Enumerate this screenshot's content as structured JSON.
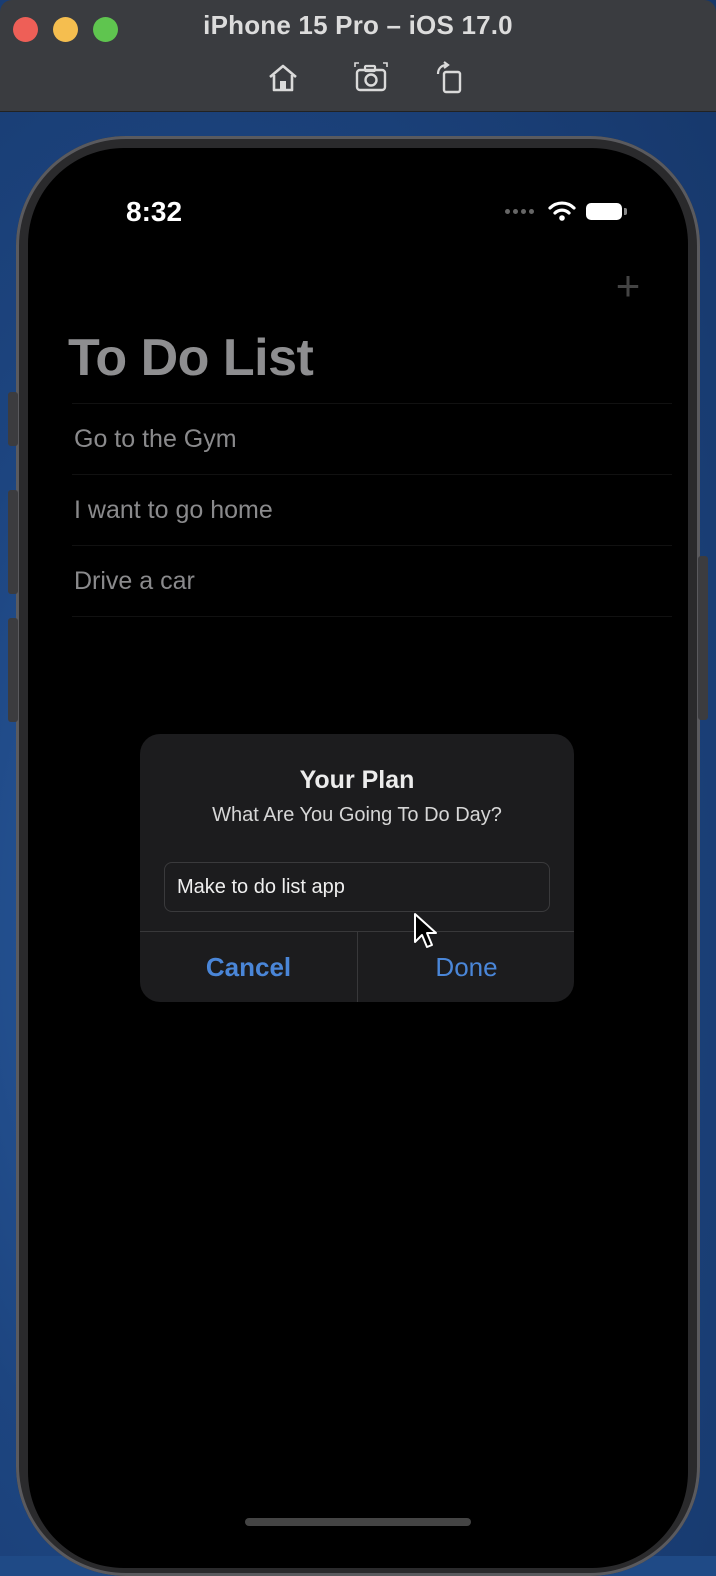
{
  "simulator": {
    "title": "iPhone 15 Pro – iOS 17.0",
    "toolbar": [
      {
        "icon": "home-icon"
      },
      {
        "icon": "screenshot-icon"
      },
      {
        "icon": "rotate-icon"
      }
    ]
  },
  "status_bar": {
    "time": "8:32",
    "icons": [
      "cellular-dots-icon",
      "wifi-icon",
      "battery-icon"
    ]
  },
  "navigation": {
    "title": "To Do List",
    "add_icon": "plus-icon"
  },
  "todo_items": [
    {
      "text": "Go to the Gym"
    },
    {
      "text": "I want to go home"
    },
    {
      "text": "Drive a car"
    }
  ],
  "alert": {
    "title": "Your Plan",
    "message": "What Are You Going To Do Day?",
    "input_value": "Make to do list app",
    "cancel_label": "Cancel",
    "done_label": "Done"
  },
  "colors": {
    "accent": "#4a86d8",
    "screen_background": "#000000",
    "alert_background": "#1c1c1e"
  }
}
